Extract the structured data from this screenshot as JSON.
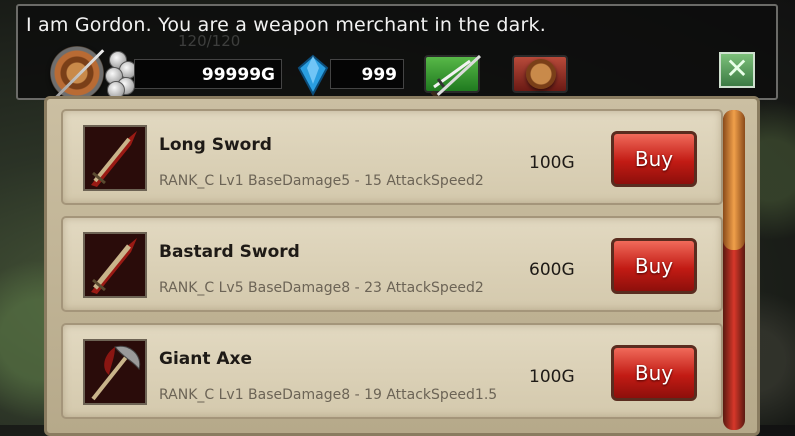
{
  "dialog": {
    "text": "I am Gordon. You are a weapon merchant in the dark.",
    "hp_ghost": "120/120"
  },
  "currency": {
    "gold": "99999G",
    "gems": "999"
  },
  "icons": {
    "player_badge": "shield-sword-icon",
    "gold": "silver-coins-icon",
    "gem": "blue-gem-icon",
    "weapon_tab": "sword-tab-icon",
    "shield_tab": "shield-tab-icon",
    "close": "close-icon"
  },
  "shop": {
    "items": [
      {
        "name": "Long Sword",
        "desc": "RANK_C Lv1 BaseDamage5 - 15 AttackSpeed2",
        "price": "100G",
        "buy_label": "Buy",
        "icon": "sword-icon"
      },
      {
        "name": "Bastard Sword",
        "desc": "RANK_C Lv5 BaseDamage8 - 23 AttackSpeed2",
        "price": "600G",
        "buy_label": "Buy",
        "icon": "sword-icon"
      },
      {
        "name": "Giant Axe",
        "desc": "RANK_C Lv1 BaseDamage8 - 19 AttackSpeed1.5",
        "price": "100G",
        "buy_label": "Buy",
        "icon": "axe-icon"
      }
    ]
  },
  "colors": {
    "buy_button": "#c21b14",
    "panel": "#cbbfa2",
    "gem": "#2a9ee0"
  }
}
